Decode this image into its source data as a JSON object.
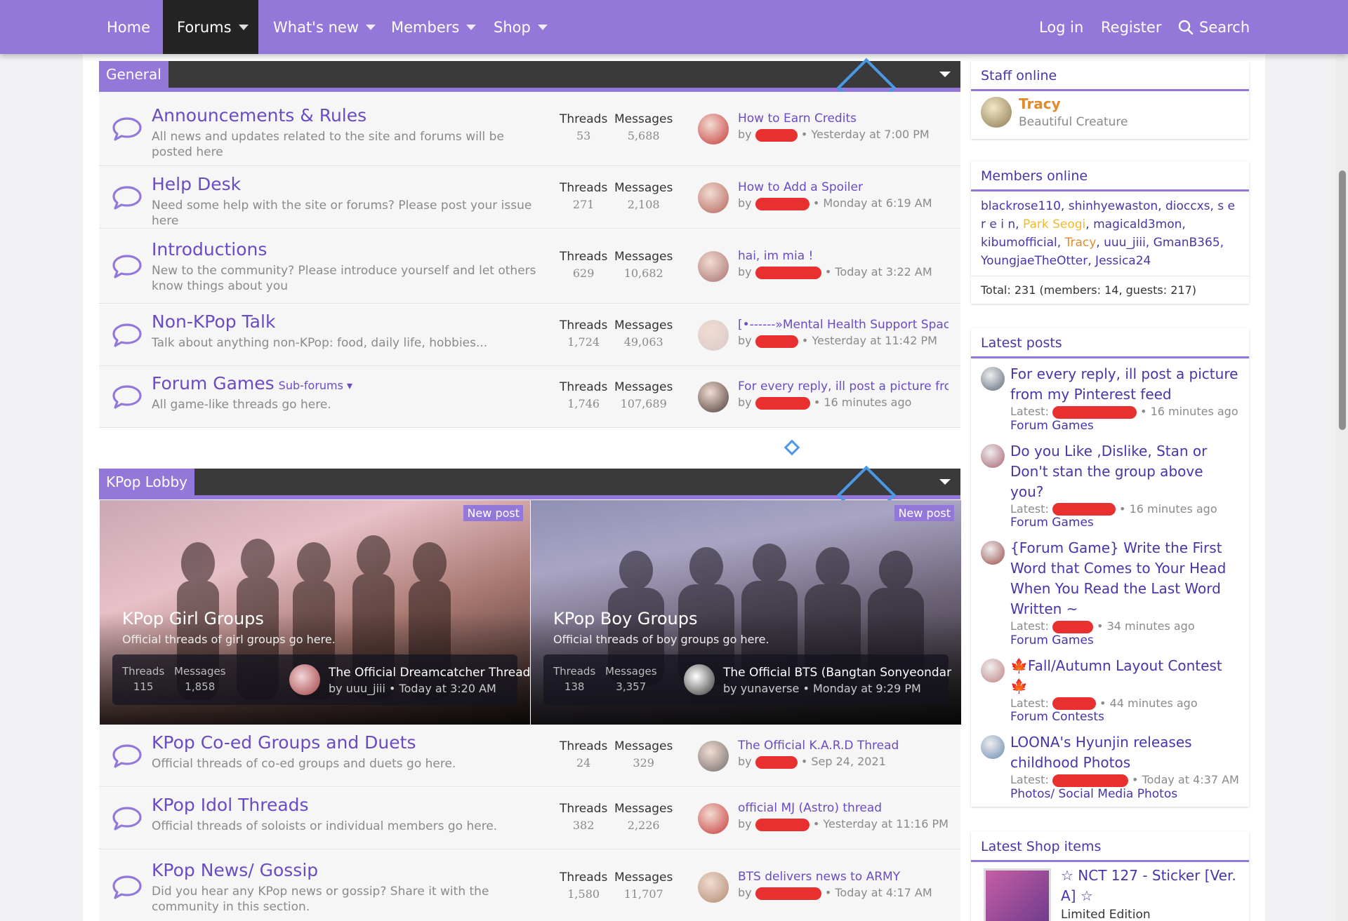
{
  "nav": {
    "home": "Home",
    "forums": "Forums",
    "whats_new": "What's new",
    "members": "Members",
    "shop": "Shop",
    "login": "Log in",
    "register": "Register",
    "search": "Search"
  },
  "general": {
    "title": "General",
    "forums": [
      {
        "title": "Announcements & Rules",
        "desc": "All news and updates related to the site and forums will be posted here",
        "threads": "53",
        "messages": "5,688",
        "lp_title": "How to Earn Credits",
        "lp_time": "Yesterday at 7:00 PM"
      },
      {
        "title": "Help Desk",
        "desc": "Need some help with the site or forums? Please post your issue here",
        "threads": "271",
        "messages": "2,108",
        "lp_title": "How to Add a Spoiler",
        "lp_time": "Monday at 6:19 AM"
      },
      {
        "title": "Introductions",
        "desc": "New to the community? Please introduce yourself and let others know things about you",
        "threads": "629",
        "messages": "10,682",
        "lp_title": "hai, im mia !",
        "lp_time": "Today at 3:22 AM"
      },
      {
        "title": "Non-KPop Talk",
        "desc": "Talk about anything non-KPop: food, daily life, hobbies...",
        "threads": "1,724",
        "messages": "49,063",
        "lp_title": "[•------»Mental Health Support Space«",
        "lp_time": "Yesterday at 11:42 PM"
      },
      {
        "title": "Forum Games",
        "sub": "Sub-forums ▾",
        "desc": "All game-like threads go here.",
        "threads": "1,746",
        "messages": "107,689",
        "lp_title": "For every reply, ill post a picture from m",
        "lp_time": "16 minutes ago"
      }
    ]
  },
  "labels": {
    "threads": "Threads",
    "messages": "Messages",
    "by": "by",
    "latest": "Latest:",
    "new_post": "New post",
    "dot": "•"
  },
  "kpop": {
    "title": "KPop Lobby",
    "tiles": [
      {
        "title": "KPop Girl Groups",
        "desc": "Official threads of girl groups go here.",
        "threads": "115",
        "messages": "1,858",
        "lp_title": "The Official Dreamcatcher Thread",
        "lp_by": "by uuu_jiii",
        "lp_time": "Today at 3:20 AM"
      },
      {
        "title": "KPop Boy Groups",
        "desc": "Official threads of boy groups go here.",
        "threads": "138",
        "messages": "3,357",
        "lp_title": "The Official BTS (Bangtan Sonyeondar",
        "lp_by": "by yunaverse",
        "lp_time": "Monday at 9:29 PM"
      }
    ],
    "forums": [
      {
        "title": "KPop Co-ed Groups and Duets",
        "desc": "Official threads of co-ed groups and duets go here.",
        "threads": "24",
        "messages": "329",
        "lp_title": "The Official K.A.R.D Thread",
        "lp_time": "Sep 24, 2021"
      },
      {
        "title": "KPop Idol Threads",
        "desc": "Official threads of soloists or individual members go here.",
        "threads": "382",
        "messages": "2,226",
        "lp_title": "official MJ (Astro) thread",
        "lp_time": "Yesterday at 11:16 PM"
      },
      {
        "title": "KPop News/ Gossip",
        "desc": "Did you hear any KPop news or gossip? Share it with the community in this section.",
        "threads": "1,580",
        "messages": "11,707",
        "lp_title": "BTS delivers news to ARMY",
        "lp_time": "Today at 4:17 AM"
      }
    ]
  },
  "sidebar": {
    "staff": {
      "title": "Staff online",
      "name": "Tracy",
      "role": "Beautiful Creature"
    },
    "members": {
      "title": "Members online",
      "list_a": "blackrose110, shinhyewaston, dioccxs, s e r e i n, ",
      "hl1": "Park Seogi",
      "list_b": ", magicald3mon, kibumofficial, ",
      "hl2": "Tracy",
      "list_c": ", uuu_jiii, GmanB365, YoungjaeTheOtter, Jessica24",
      "total": "Total: 231 (members: 14, guests: 217)"
    },
    "latest": {
      "title": "Latest posts",
      "posts": [
        {
          "title": "For every reply, ill post a picture from my Pinterest feed",
          "time": "16 minutes ago",
          "forum": "Forum Games"
        },
        {
          "title": "Do you Like ,Dislike, Stan or Don't stan the group above you?",
          "time": "16 minutes ago",
          "forum": "Forum Games"
        },
        {
          "title": "{Forum Game} Write the First Word that Comes to Your Head When You Read the Last Word Written ~",
          "time": "34 minutes ago",
          "forum": "Forum Games"
        },
        {
          "title": "🍁Fall/Autumn Layout Contest🍁",
          "time": "44 minutes ago",
          "forum": "Forum Contests"
        },
        {
          "title": "LOONA's Hyunjin releases childhood Photos",
          "time": "Today at 4:37 AM",
          "forum": "Photos/ Social Media Photos"
        }
      ]
    },
    "shop": {
      "title": "Latest Shop items",
      "item": "☆ NCT 127 - Sticker [Ver. A] ☆",
      "edition": "Limited Edition"
    }
  }
}
